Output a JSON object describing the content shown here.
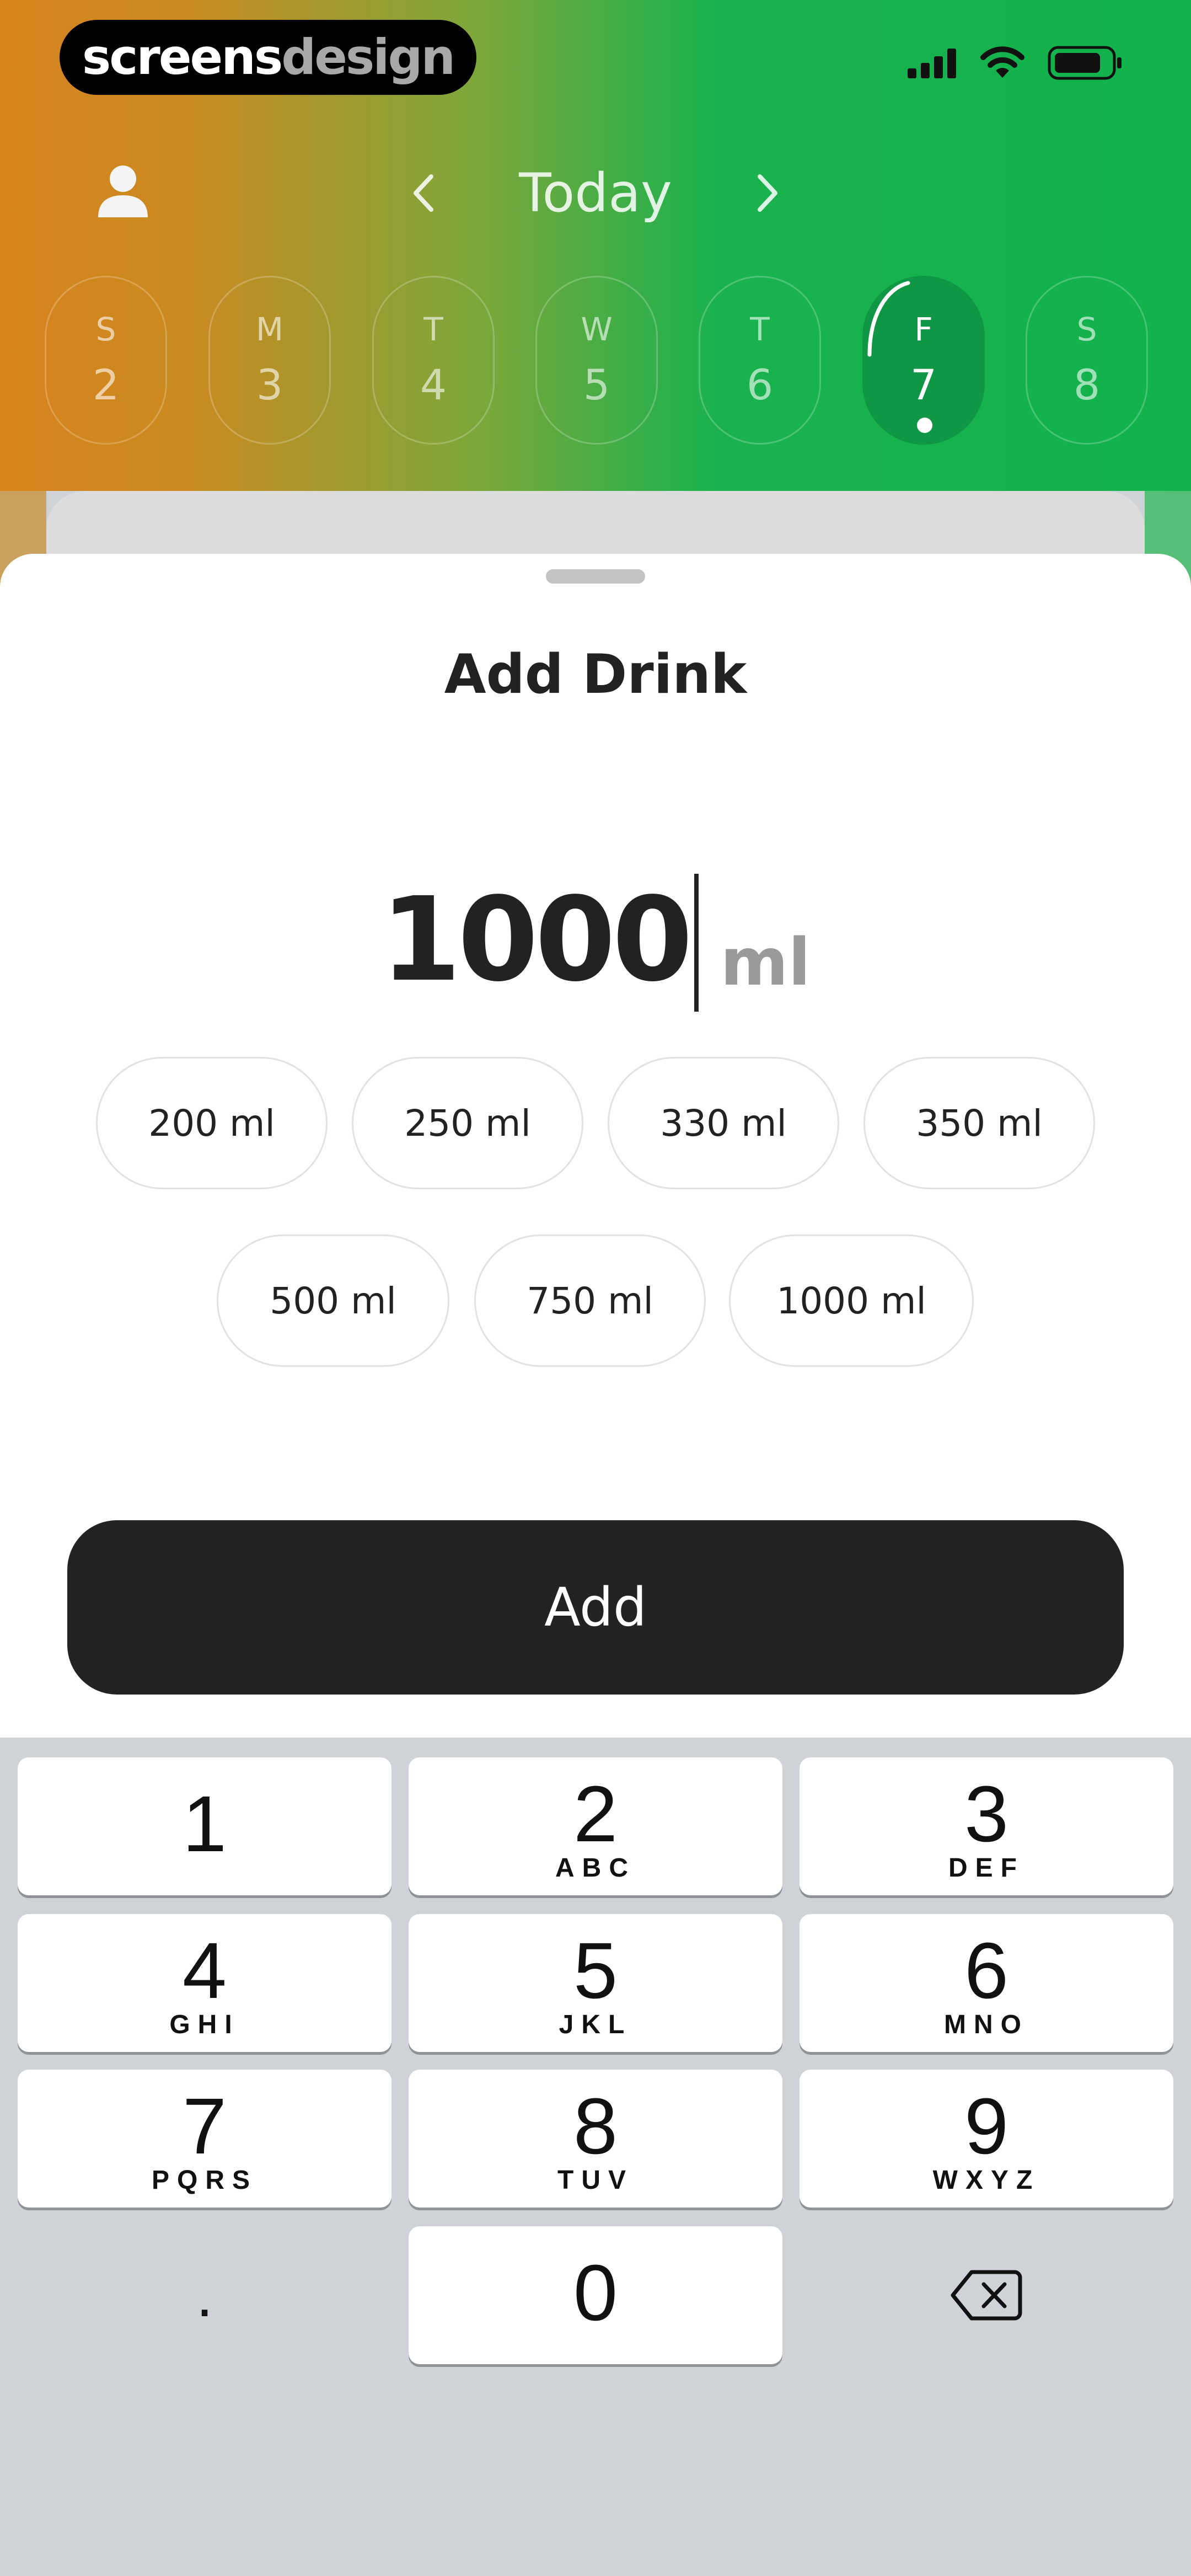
{
  "brand": {
    "part1": "screens",
    "part2": "design"
  },
  "status_bar": {
    "icons": [
      "signal-icon",
      "wifi-icon",
      "battery-icon"
    ]
  },
  "header": {
    "date_label": "Today",
    "days": [
      {
        "letter": "S",
        "number": "2"
      },
      {
        "letter": "M",
        "number": "3"
      },
      {
        "letter": "T",
        "number": "4"
      },
      {
        "letter": "W",
        "number": "5"
      },
      {
        "letter": "T",
        "number": "6"
      },
      {
        "letter": "F",
        "number": "7",
        "selected": true
      },
      {
        "letter": "S",
        "number": "8"
      }
    ]
  },
  "sheet": {
    "title": "Add Drink",
    "amount": "1000",
    "unit": "ml",
    "presets": [
      "200 ml",
      "250 ml",
      "330 ml",
      "350 ml",
      "500 ml",
      "750 ml",
      "1000 ml"
    ],
    "add_label": "Add"
  },
  "keyboard": {
    "keys": [
      {
        "digit": "1",
        "letters": ""
      },
      {
        "digit": "2",
        "letters": "ABC"
      },
      {
        "digit": "3",
        "letters": "DEF"
      },
      {
        "digit": "4",
        "letters": "GHI"
      },
      {
        "digit": "5",
        "letters": "JKL"
      },
      {
        "digit": "6",
        "letters": "MNO"
      },
      {
        "digit": "7",
        "letters": "PQRS"
      },
      {
        "digit": "8",
        "letters": "TUV"
      },
      {
        "digit": "9",
        "letters": "WXYZ"
      },
      {
        "digit": "0",
        "letters": ""
      }
    ],
    "decimal": "."
  },
  "colors": {
    "accent_green": "#11b24d",
    "selected_day": "#0f9745",
    "orange": "#d8831e",
    "button_dark": "#232323"
  }
}
